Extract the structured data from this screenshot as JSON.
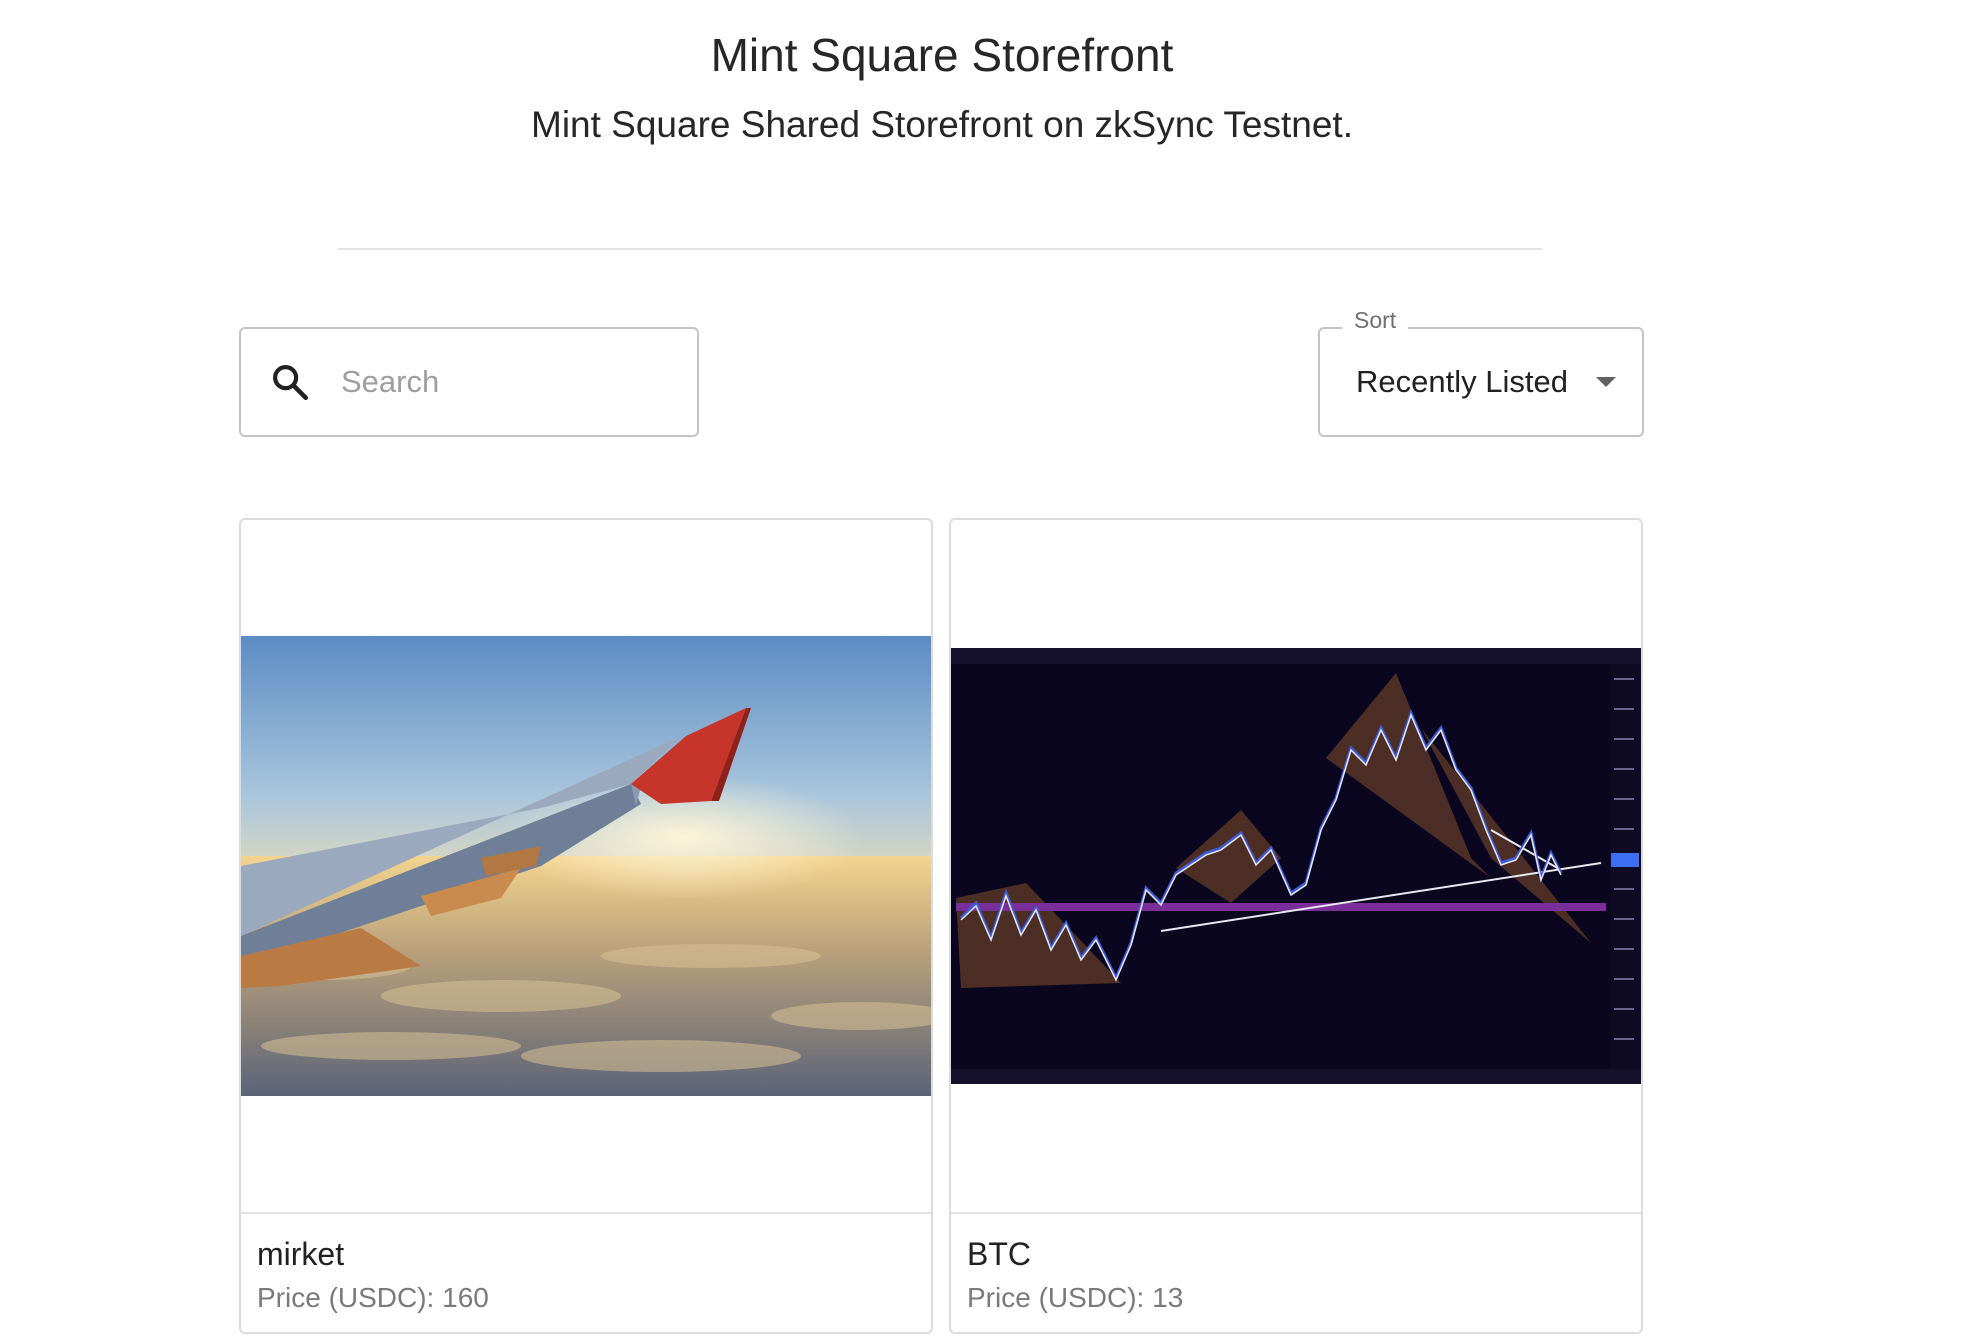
{
  "header": {
    "title": "Mint Square Storefront",
    "subtitle": "Mint Square Shared Storefront on zkSync Testnet."
  },
  "search": {
    "placeholder": "Search",
    "value": "",
    "icon": "search-icon"
  },
  "sort": {
    "label": "Sort",
    "selected": "Recently Listed",
    "icon": "chevron-down-icon"
  },
  "listings": [
    {
      "name": "mirket",
      "price_label": "Price (USDC): 160",
      "price": 160,
      "currency": "USDC",
      "image": "airplane-wing-over-clouds"
    },
    {
      "name": "BTC",
      "price_label": "Price (USDC): 13",
      "price": 13,
      "currency": "USDC",
      "image": "btc-tradingview-chart"
    }
  ],
  "colors": {
    "text": "#212121",
    "muted": "#7a7a7a",
    "border": "#c4c4c4"
  }
}
